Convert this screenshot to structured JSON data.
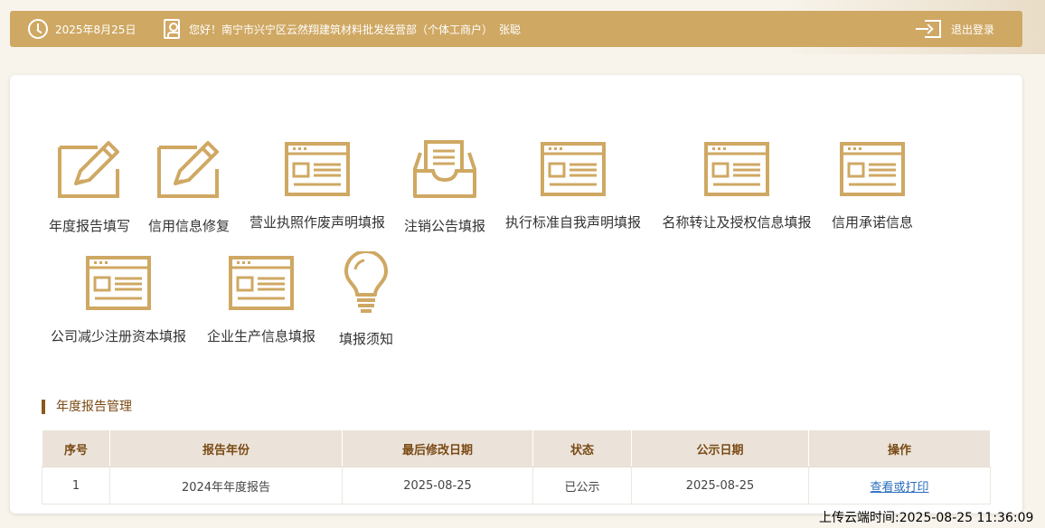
{
  "header": {
    "date": "2025年8月25日",
    "greeting": "您好！南宁市兴宁区云然翔建筑材料批发经营部（个体工商户）",
    "user_name": "张聪",
    "logout_label": "退出登录"
  },
  "tiles": [
    {
      "label": "年度报告填写",
      "icon": "edit-icon"
    },
    {
      "label": "信用信息修复",
      "icon": "edit-icon"
    },
    {
      "label": "营业执照作废声明填报",
      "icon": "form-window-icon"
    },
    {
      "label": "注销公告填报",
      "icon": "inbox-document-icon"
    },
    {
      "label": "执行标准自我声明填报",
      "icon": "form-window-icon"
    },
    {
      "label": "名称转让及授权信息填报",
      "icon": "form-window-icon"
    },
    {
      "label": "信用承诺信息",
      "icon": "form-window-icon"
    },
    {
      "label": "公司减少注册资本填报",
      "icon": "form-window-icon"
    },
    {
      "label": "企业生产信息填报",
      "icon": "form-window-icon"
    },
    {
      "label": "填报须知",
      "icon": "lightbulb-icon"
    }
  ],
  "section": {
    "title": "年度报告管理"
  },
  "table": {
    "headers": [
      "序号",
      "报告年份",
      "最后修改日期",
      "状态",
      "公示日期",
      "操作"
    ],
    "rows": [
      [
        "1",
        "2024年年度报告",
        "2025-08-25",
        "已公示",
        "2025-08-25",
        "查看或打印"
      ]
    ]
  },
  "footer": {
    "upload_time": "上传云端时间:2025-08-25 11:36:09"
  },
  "colors": {
    "accent": "#cfa863",
    "heading": "#7a4a14",
    "link": "#2a6cbf"
  }
}
